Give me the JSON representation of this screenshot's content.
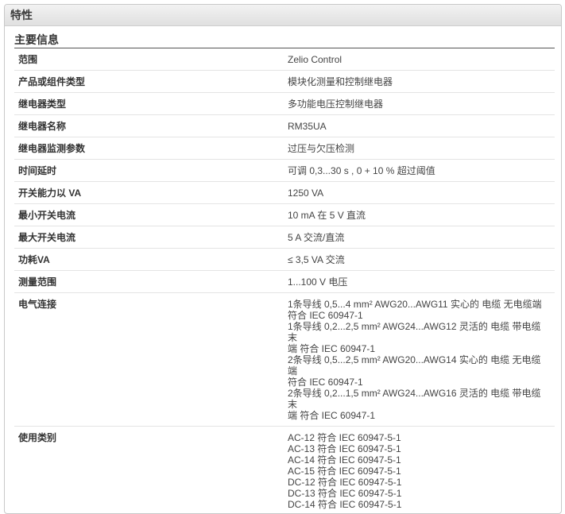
{
  "panel": {
    "title": "特性"
  },
  "section": {
    "title": "主要信息"
  },
  "rows": [
    {
      "label": "范围",
      "value": [
        "Zelio Control"
      ]
    },
    {
      "label": "产品或组件类型",
      "value": [
        "模块化测量和控制继电器"
      ]
    },
    {
      "label": "继电器类型",
      "value": [
        "多功能电压控制继电器"
      ]
    },
    {
      "label": "继电器名称",
      "value": [
        "RM35UA"
      ]
    },
    {
      "label": "继电器监测参数",
      "value": [
        "过压与欠压检测"
      ]
    },
    {
      "label": "时间延时",
      "value": [
        "可调 0,3...30 s , 0 + 10 % 超过阈值"
      ]
    },
    {
      "label": "开关能力以 VA",
      "value": [
        "1250 VA"
      ]
    },
    {
      "label": "最小开关电流",
      "value": [
        "10 mA 在 5 V 直流"
      ]
    },
    {
      "label": "最大开关电流",
      "value": [
        "5 A 交流/直流"
      ]
    },
    {
      "label": "功耗VA",
      "value": [
        "≤ 3,5 VA 交流"
      ]
    },
    {
      "label": "测量范围",
      "value": [
        "1...100 V 电压"
      ]
    },
    {
      "label": "电气连接",
      "value": [
        "1条导线 0,5...4 mm² AWG20...AWG11 实心的 电缆 无电缆端",
        "符合 IEC 60947-1",
        "1条导线 0,2...2,5 mm² AWG24...AWG12 灵活的 电缆 带电缆末",
        "端 符合 IEC 60947-1",
        "2条导线 0,5...2,5 mm² AWG20...AWG14 实心的 电缆 无电缆端",
        "符合 IEC 60947-1",
        "2条导线 0,2...1,5 mm² AWG24...AWG16 灵活的 电缆 带电缆末",
        "端 符合 IEC 60947-1"
      ]
    },
    {
      "label": "使用类别",
      "value": [
        "AC-12 符合 IEC 60947-5-1",
        "AC-13 符合 IEC 60947-5-1",
        "AC-14 符合 IEC 60947-5-1",
        "AC-15 符合 IEC 60947-5-1",
        "DC-12 符合 IEC 60947-5-1",
        "DC-13 符合 IEC 60947-5-1",
        "DC-14 符合 IEC 60947-5-1"
      ]
    }
  ]
}
